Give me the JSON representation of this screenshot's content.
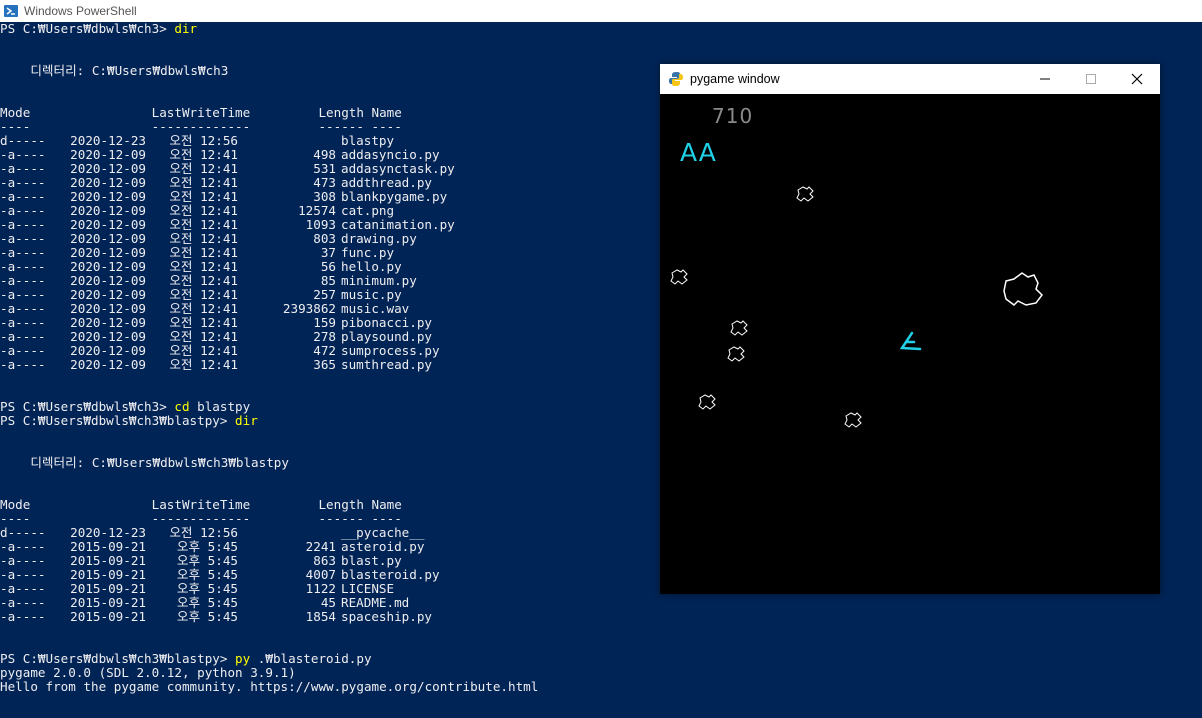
{
  "powershell": {
    "title": "Windows PowerShell",
    "lines": [
      {
        "prompt": "PS C:₩Users₩dbwls₩ch3> ",
        "cmd": "dir"
      },
      {
        "text": ""
      },
      {
        "text": ""
      },
      {
        "text": "    디렉터리: C:₩Users₩dbwls₩ch3"
      },
      {
        "text": ""
      },
      {
        "text": ""
      },
      {
        "text": "Mode                LastWriteTime         Length Name"
      },
      {
        "text": "----                -------------         ------ ----"
      },
      {
        "row": [
          "d-----",
          "2020-12-23",
          "오전 12:56",
          "",
          "blastpy"
        ]
      },
      {
        "row": [
          "-a----",
          "2020-12-09",
          "오전 12:41",
          "498",
          "addasyncio.py"
        ]
      },
      {
        "row": [
          "-a----",
          "2020-12-09",
          "오전 12:41",
          "531",
          "addasynctask.py"
        ]
      },
      {
        "row": [
          "-a----",
          "2020-12-09",
          "오전 12:41",
          "473",
          "addthread.py"
        ]
      },
      {
        "row": [
          "-a----",
          "2020-12-09",
          "오전 12:41",
          "308",
          "blankpygame.py"
        ]
      },
      {
        "row": [
          "-a----",
          "2020-12-09",
          "오전 12:41",
          "12574",
          "cat.png"
        ]
      },
      {
        "row": [
          "-a----",
          "2020-12-09",
          "오전 12:41",
          "1093",
          "catanimation.py"
        ]
      },
      {
        "row": [
          "-a----",
          "2020-12-09",
          "오전 12:41",
          "803",
          "drawing.py"
        ]
      },
      {
        "row": [
          "-a----",
          "2020-12-09",
          "오전 12:41",
          "37",
          "func.py"
        ]
      },
      {
        "row": [
          "-a----",
          "2020-12-09",
          "오전 12:41",
          "56",
          "hello.py"
        ]
      },
      {
        "row": [
          "-a----",
          "2020-12-09",
          "오전 12:41",
          "85",
          "minimum.py"
        ]
      },
      {
        "row": [
          "-a----",
          "2020-12-09",
          "오전 12:41",
          "257",
          "music.py"
        ]
      },
      {
        "row": [
          "-a----",
          "2020-12-09",
          "오전 12:41",
          "2393862",
          "music.wav"
        ]
      },
      {
        "row": [
          "-a----",
          "2020-12-09",
          "오전 12:41",
          "159",
          "pibonacci.py"
        ]
      },
      {
        "row": [
          "-a----",
          "2020-12-09",
          "오전 12:41",
          "278",
          "playsound.py"
        ]
      },
      {
        "row": [
          "-a----",
          "2020-12-09",
          "오전 12:41",
          "472",
          "sumprocess.py"
        ]
      },
      {
        "row": [
          "-a----",
          "2020-12-09",
          "오전 12:41",
          "365",
          "sumthread.py"
        ]
      },
      {
        "text": ""
      },
      {
        "text": ""
      },
      {
        "prompt": "PS C:₩Users₩dbwls₩ch3> ",
        "cmd": "cd",
        "rest": " blastpy"
      },
      {
        "prompt": "PS C:₩Users₩dbwls₩ch3₩blastpy> ",
        "cmd": "dir"
      },
      {
        "text": ""
      },
      {
        "text": ""
      },
      {
        "text": "    디렉터리: C:₩Users₩dbwls₩ch3₩blastpy"
      },
      {
        "text": ""
      },
      {
        "text": ""
      },
      {
        "text": "Mode                LastWriteTime         Length Name"
      },
      {
        "text": "----                -------------         ------ ----"
      },
      {
        "row": [
          "d-----",
          "2020-12-23",
          "오전 12:56",
          "",
          "__pycache__"
        ]
      },
      {
        "row": [
          "-a----",
          "2015-09-21",
          "오후 5:45",
          "2241",
          "asteroid.py"
        ]
      },
      {
        "row": [
          "-a----",
          "2015-09-21",
          "오후 5:45",
          "863",
          "blast.py"
        ]
      },
      {
        "row": [
          "-a----",
          "2015-09-21",
          "오후 5:45",
          "4007",
          "blasteroid.py"
        ]
      },
      {
        "row": [
          "-a----",
          "2015-09-21",
          "오후 5:45",
          "1122",
          "LICENSE"
        ]
      },
      {
        "row": [
          "-a----",
          "2015-09-21",
          "오후 5:45",
          "45",
          "README.md"
        ]
      },
      {
        "row": [
          "-a----",
          "2015-09-21",
          "오후 5:45",
          "1854",
          "spaceship.py"
        ]
      },
      {
        "text": ""
      },
      {
        "text": ""
      },
      {
        "prompt": "PS C:₩Users₩dbwls₩ch3₩blastpy> ",
        "cmd": "py",
        "rest": " .₩blasteroid.py"
      },
      {
        "text": "pygame 2.0.0 (SDL 2.0.12, python 3.9.1)"
      },
      {
        "text": "Hello from the pygame community. https://www.pygame.org/contribute.html"
      }
    ]
  },
  "pygame_window": {
    "title": "pygame window",
    "score": "710",
    "lives": "AA",
    "colors": {
      "ship": "#1fd0e6",
      "asteroid": "#ffffff",
      "score": "#8a8a8a"
    }
  }
}
